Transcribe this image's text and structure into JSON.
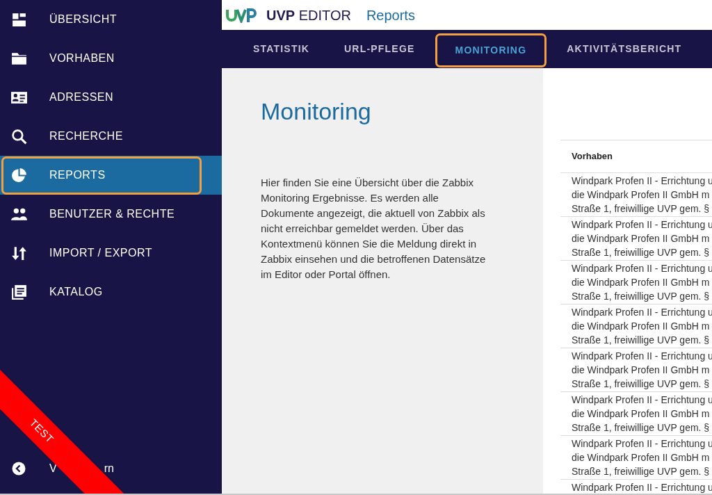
{
  "sidebar": {
    "items": [
      {
        "label": "ÜBERSICHT",
        "selected": false
      },
      {
        "label": "VORHABEN",
        "selected": false
      },
      {
        "label": "ADRESSEN",
        "selected": false
      },
      {
        "label": "RECHERCHE",
        "selected": false
      },
      {
        "label": "REPORTS",
        "selected": true
      },
      {
        "label": "BENUTZER & RECHTE",
        "selected": false
      },
      {
        "label": "IMPORT / EXPORT",
        "selected": false
      },
      {
        "label": "KATALOG",
        "selected": false
      }
    ],
    "collapse": {
      "label_start": "V",
      "label_end": "rn"
    },
    "ribbon": "TEST"
  },
  "header": {
    "app_bold": "UVP",
    "app_rest": "EDITOR",
    "page": "Reports"
  },
  "tabs": [
    {
      "label": "STATISTIK",
      "selected": false
    },
    {
      "label": "URL-PFLEGE",
      "selected": false
    },
    {
      "label": "MONITORING",
      "selected": true
    },
    {
      "label": "AKTIVITÄTSBERICHT",
      "selected": false
    }
  ],
  "intro": {
    "title": "Monitoring",
    "text": "Hier finden Sie eine Übersicht über die Zabbix Monitoring Ergebnisse. Es werden alle Dokumente angezeigt, die aktuell von Zabbix als nicht erreichbar gemeldet werden. Über das Kontextmenü können Sie die Meldung direkt in Zabbix einsehen und die betroffenen Datensätze im Editor oder Portal öffnen."
  },
  "table": {
    "columns": [
      "Vorhaben"
    ],
    "rows": [
      {
        "lines": [
          "Windpark Profen II - Errichtung u",
          "die Windpark Profen II GmbH m",
          "Straße 1, freiwillige UVP gem. §"
        ]
      },
      {
        "lines": [
          "Windpark Profen II - Errichtung u",
          "die Windpark Profen II GmbH m",
          "Straße 1, freiwillige UVP gem. §"
        ]
      },
      {
        "lines": [
          "Windpark Profen II - Errichtung u",
          "die Windpark Profen II GmbH m",
          "Straße 1, freiwillige UVP gem. §"
        ]
      },
      {
        "lines": [
          "Windpark Profen II - Errichtung u",
          "die Windpark Profen II GmbH m",
          "Straße 1, freiwillige UVP gem. §"
        ]
      },
      {
        "lines": [
          "Windpark Profen II - Errichtung u",
          "die Windpark Profen II GmbH m",
          "Straße 1, freiwillige UVP gem. §"
        ]
      },
      {
        "lines": [
          "Windpark Profen II - Errichtung u",
          "die Windpark Profen II GmbH m",
          "Straße 1, freiwillige UVP gem. §"
        ]
      },
      {
        "lines": [
          "Windpark Profen II - Errichtung u",
          "die Windpark Profen II GmbH m",
          "Straße 1, freiwillige UVP gem. §"
        ]
      },
      {
        "lines": [
          "Windpark Profen II - Errichtung u"
        ]
      }
    ]
  }
}
